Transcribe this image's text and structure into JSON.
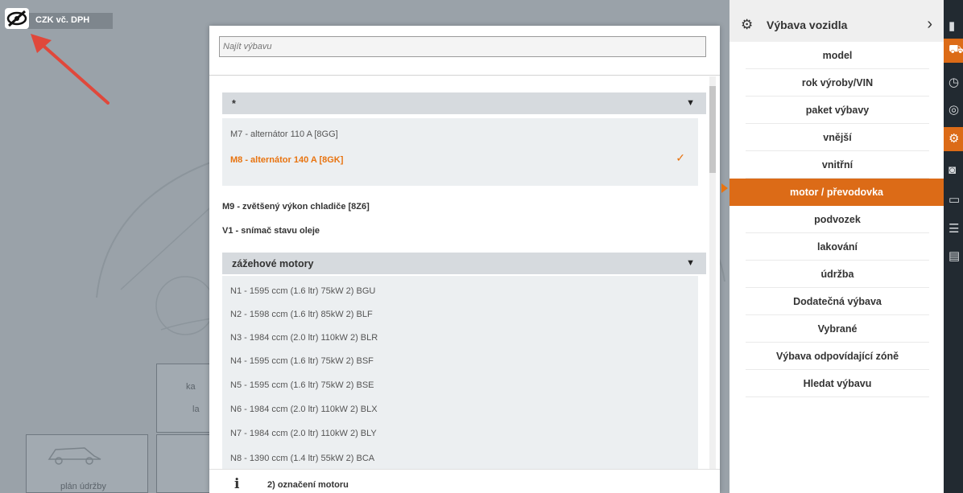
{
  "background": {
    "price_label": "CZK vč. DPH",
    "tile_left_label": "plán údržby",
    "tile_text_1": "ka",
    "tile_text_2": "la"
  },
  "search": {
    "placeholder": "Najít výbavu"
  },
  "groups": [
    {
      "header": "*",
      "options": [
        {
          "label": "M7 - alternátor 110 A [8GG]",
          "selected": false
        },
        {
          "label": "M8 - alternátor 140 A [8GK]",
          "selected": true
        }
      ]
    },
    {
      "header": "zážehové motory",
      "options": [
        {
          "label": "N1 - 1595 ccm (1.6 ltr) 75kW 2) BGU"
        },
        {
          "label": "N2 - 1598 ccm (1.6 ltr) 85kW 2) BLF"
        },
        {
          "label": "N3 - 1984 ccm (2.0 ltr) 110kW 2) BLR"
        },
        {
          "label": "N4 - 1595 ccm (1.6 ltr) 75kW 2) BSF"
        },
        {
          "label": "N5 - 1595 ccm (1.6 ltr) 75kW 2) BSE"
        },
        {
          "label": "N6 - 1984 ccm (2.0 ltr) 110kW 2) BLX"
        },
        {
          "label": "N7 - 1984 ccm (2.0 ltr) 110kW 2) BLY"
        },
        {
          "label": "N8 - 1390 ccm (1.4 ltr) 55kW 2) BCA"
        }
      ]
    }
  ],
  "standalone_options": [
    "M9 - zvětšený výkon chladiče [8Z6]",
    "V1 - snímač stavu oleje"
  ],
  "footer": {
    "info_glyph": "i",
    "text": "2) označení motoru"
  },
  "menu": {
    "title": "Výbava vozidla",
    "items": [
      {
        "label": "model"
      },
      {
        "label": "rok výroby/VIN"
      },
      {
        "label": "paket výbavy"
      },
      {
        "label": "vnější"
      },
      {
        "label": "vnitřní"
      },
      {
        "label": "motor / převodovka",
        "active": true
      },
      {
        "label": "podvozek"
      },
      {
        "label": "lakování"
      },
      {
        "label": "údržba"
      },
      {
        "label": "Dodatečná výbava"
      },
      {
        "label": "Vybrané"
      },
      {
        "label": "Výbava odpovídající zóně"
      },
      {
        "label": "Hledat výbavu"
      }
    ]
  },
  "colors": {
    "accent": "#dc6b17",
    "selected_text": "#e8730f",
    "strip_bg": "#222a31"
  },
  "strip_icons": [
    "book-icon",
    "car-icon",
    "clock-icon",
    "target-icon",
    "gear-icon",
    "camera-icon",
    "monitor-icon",
    "list-icon",
    "document-icon"
  ]
}
